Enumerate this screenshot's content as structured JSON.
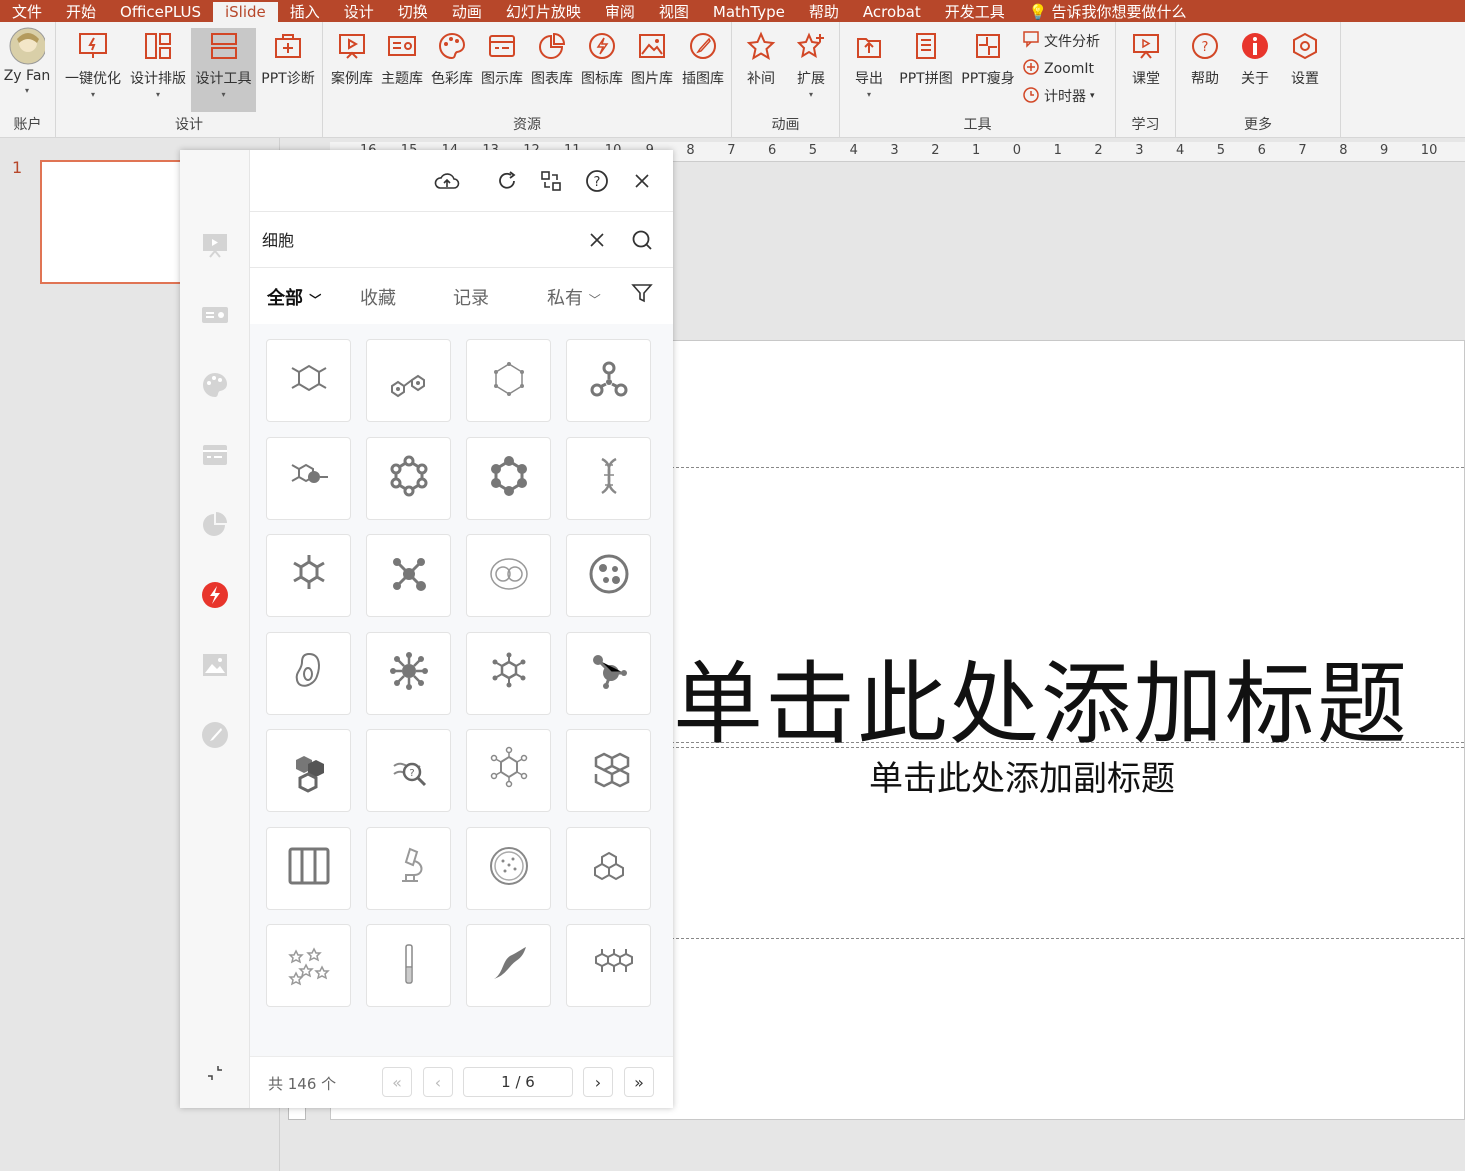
{
  "tabs": [
    "文件",
    "开始",
    "OfficePLUS",
    "iSlide",
    "插入",
    "设计",
    "切换",
    "动画",
    "幻灯片放映",
    "审阅",
    "视图",
    "MathType",
    "帮助",
    "Acrobat",
    "开发工具"
  ],
  "active_tab": "iSlide",
  "tell_me": "告诉我你想要做什么",
  "account": {
    "name": "Zy Fan",
    "group_label": "账户"
  },
  "design_group": {
    "label": "设计",
    "buttons": [
      "一键优化",
      "设计排版",
      "设计工具",
      "PPT诊断"
    ]
  },
  "resource_group": {
    "label": "资源",
    "buttons": [
      "案例库",
      "主题库",
      "色彩库",
      "图示库",
      "图表库",
      "图标库",
      "图片库",
      "插图库"
    ]
  },
  "anim_group": {
    "label": "动画",
    "buttons": [
      "补间",
      "扩展"
    ]
  },
  "tools_group": {
    "label": "工具",
    "buttons": [
      "导出",
      "PPT拼图",
      "PPT瘦身"
    ],
    "small": [
      "文件分析",
      "ZoomIt",
      "计时器"
    ]
  },
  "learn_group": {
    "label": "学习",
    "buttons": [
      "课堂"
    ]
  },
  "more_group": {
    "label": "更多",
    "buttons": [
      "帮助",
      "关于",
      "设置"
    ]
  },
  "slide_number": "1",
  "ruler_ticks": [
    "16",
    "15",
    "14",
    "13",
    "12",
    "11",
    "10",
    "9",
    "8",
    "7",
    "6",
    "5",
    "4",
    "3",
    "2",
    "1",
    "0",
    "1",
    "2",
    "3",
    "4",
    "5",
    "6",
    "7",
    "8",
    "9",
    "10"
  ],
  "slide": {
    "title": "单击此处添加标题",
    "subtitle": "单击此处添加副标题"
  },
  "panel": {
    "search_value": "细胞",
    "filters": [
      "全部",
      "收藏",
      "记录",
      "私有"
    ],
    "total": "共 146 个",
    "page": "1 / 6"
  },
  "icons": [
    "molecule-hexagon-icon",
    "molecule-chain-icon",
    "benzene-ring-icon",
    "molecule-tri-icon",
    "molecule-hex-dot-icon",
    "ring-dots-icon",
    "ring-dots-filled-icon",
    "dna-icon",
    "hexagon-bonds-icon",
    "molecule-nodes-icon",
    "cell-division-icon",
    "petri-cell-icon",
    "bacteria-icon",
    "atom-star-icon",
    "molecule-network-icon",
    "molecule-ball-icon",
    "hexagons-cluster-icon",
    "dna-magnifier-icon",
    "hexagon-spokes-icon",
    "honeycomb-icon",
    "cell-grid-icon",
    "microscope-icon",
    "petri-dish-icon",
    "hexagon-outline-icon",
    "stars-scatter-icon",
    "test-tube-icon",
    "sperm-icon",
    "molecule-triple-icon"
  ]
}
